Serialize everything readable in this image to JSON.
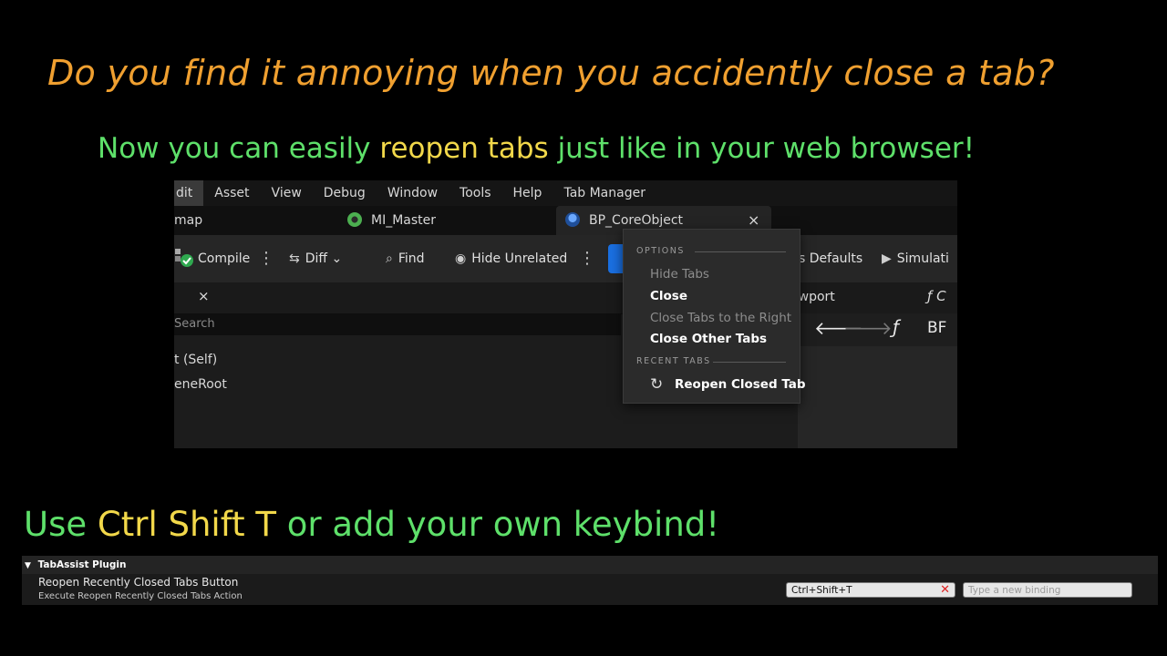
{
  "headline": "Do you find it annoying when you accidently close a tab?",
  "subline": {
    "part1": "Now you can easily ",
    "highlight": "reopen tabs",
    "part2": " just like in your web browser!"
  },
  "bottomline": {
    "part1": "Use ",
    "highlight": "Ctrl Shift T",
    "part2": " or add your own keybind!"
  },
  "editor": {
    "menu": [
      "dit",
      "Asset",
      "View",
      "Debug",
      "Window",
      "Tools",
      "Help",
      "Tab Manager"
    ],
    "tabs": {
      "left": "map",
      "mi_master": "MI_Master",
      "bp_coreobject": "BP_CoreObject",
      "close_glyph": "×"
    },
    "toolbar": {
      "compile": "Compile",
      "diff": "Diff",
      "find": "Find",
      "hide_unrelated": "Hide Unrelated",
      "class_defaults": "s Defaults",
      "simulation": "Simulati"
    },
    "panel": {
      "close_glyph": "×",
      "search_placeholder": "Search",
      "viewport_tab": "ewport",
      "func_tab": "C",
      "bp_label": "BF"
    },
    "tree": [
      "t (Self)",
      "eneRoot"
    ]
  },
  "context_menu": {
    "options_header": "OPTIONS",
    "hide_tabs": "Hide Tabs",
    "close": "Close",
    "close_right": "Close Tabs to the Right",
    "close_other": "Close Other Tabs",
    "recent_header": "RECENT TABS",
    "reopen": "Reopen Closed Tab"
  },
  "keybinding": {
    "section": "TabAssist Plugin",
    "title": "Reopen Recently Closed Tabs Button",
    "description": "Execute Reopen Recently Closed Tabs Action",
    "binding_value": "Ctrl+Shift+T",
    "new_binding_placeholder": "Type a new binding"
  },
  "colors": {
    "orange": "#f0a030",
    "green": "#5ee06a",
    "yellow": "#f2d84a",
    "accent_blue": "#1a6fe0"
  }
}
